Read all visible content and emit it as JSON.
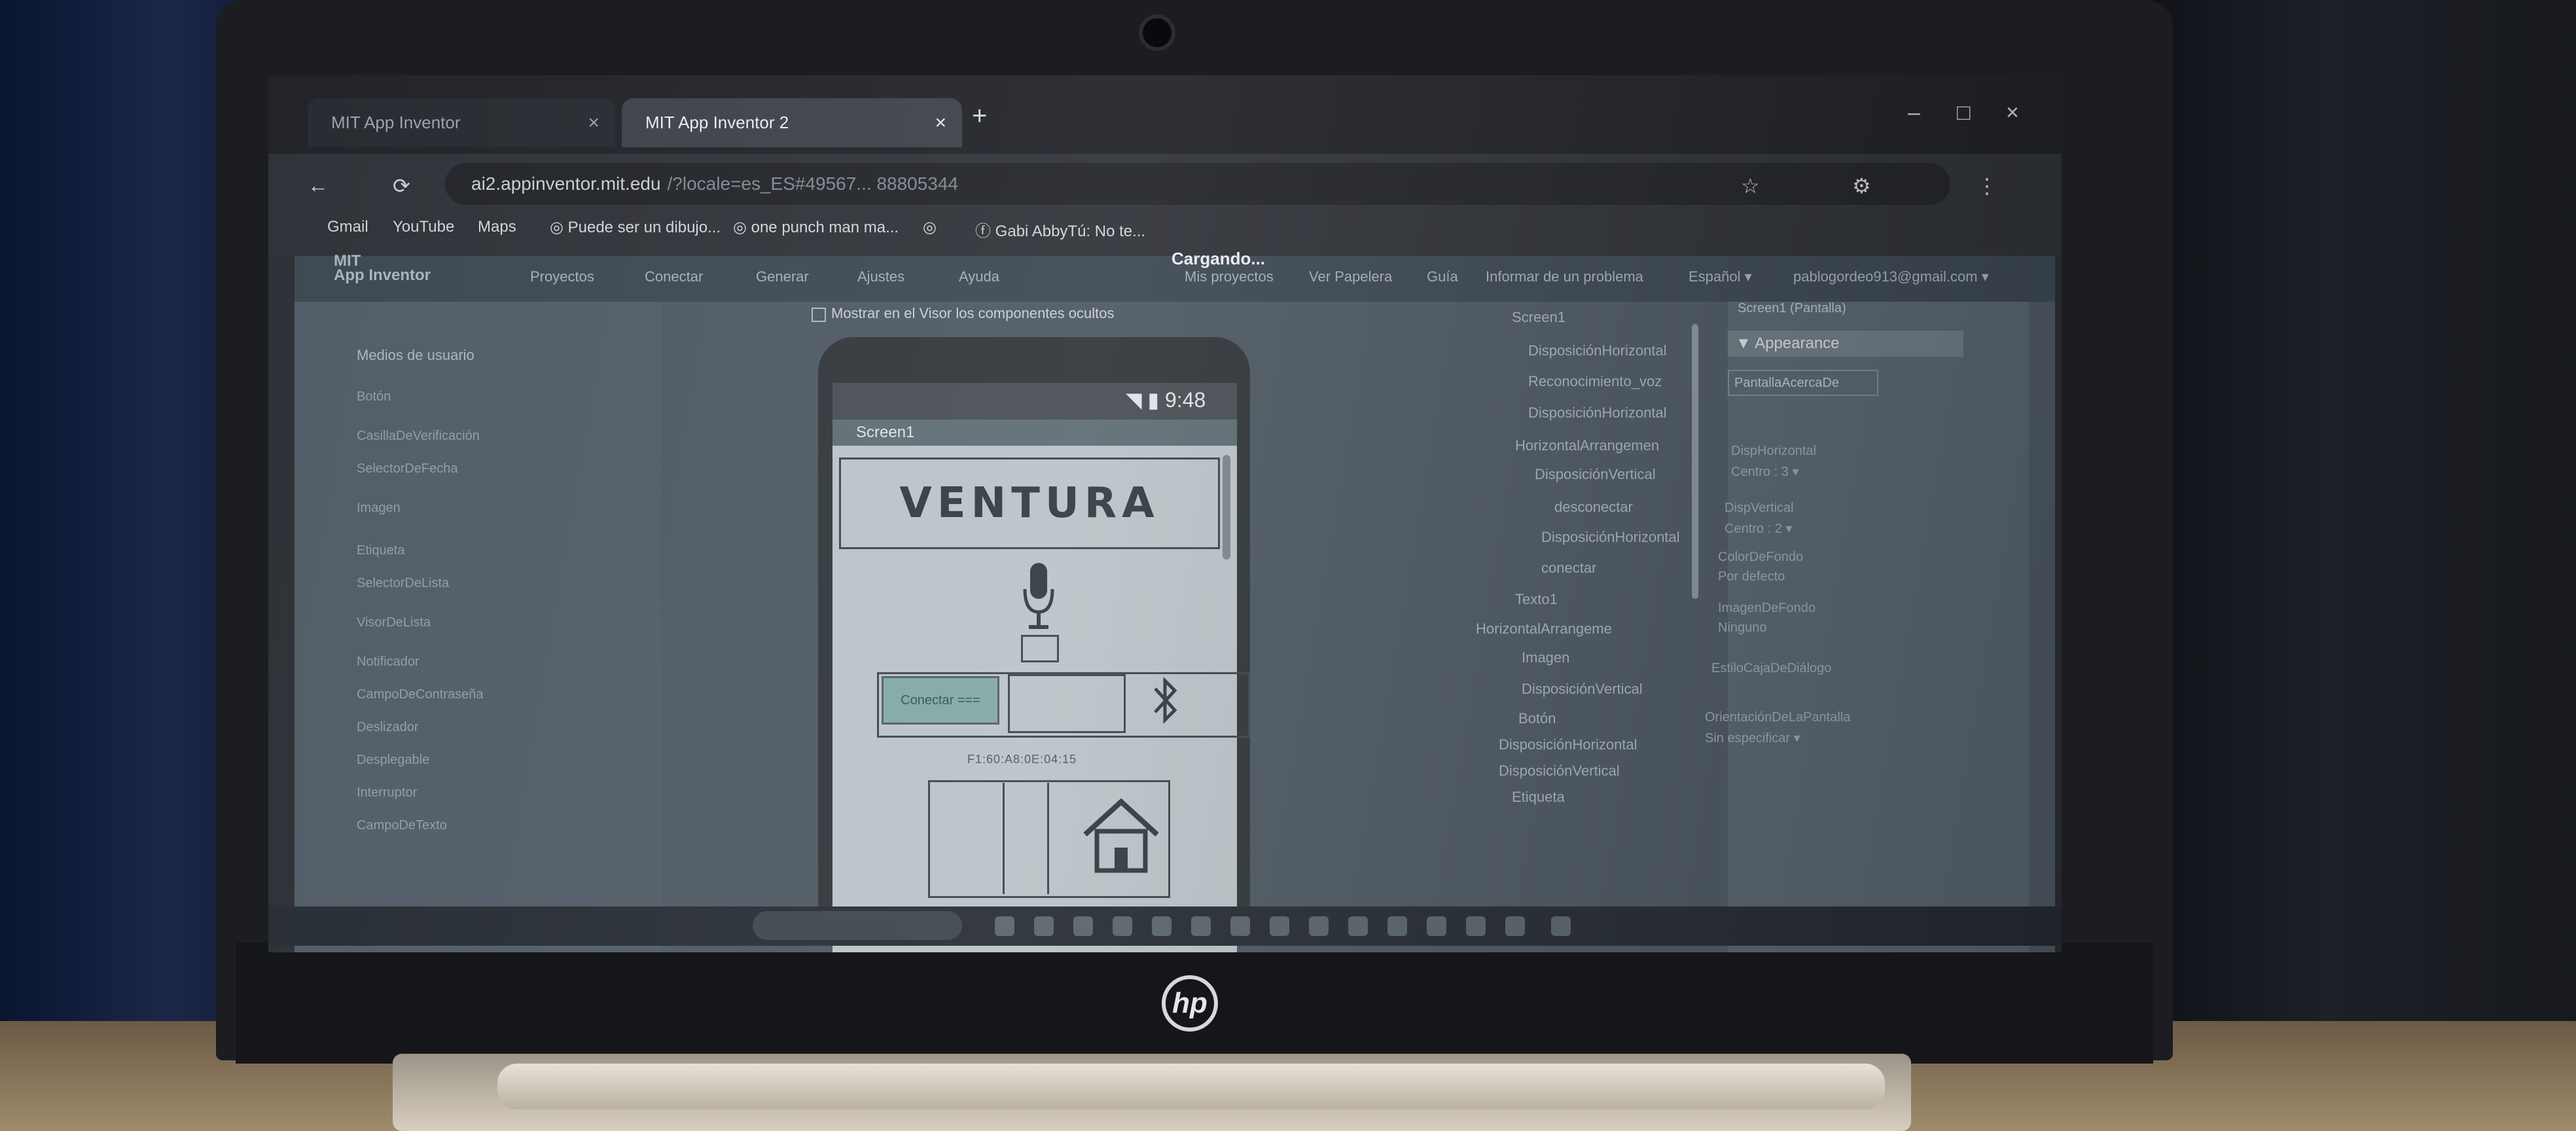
{
  "browser": {
    "tabs": [
      {
        "label": "MIT App Inventor"
      },
      {
        "label": "MIT App Inventor 2"
      }
    ],
    "tab_close_glyph": "×",
    "new_tab_glyph": "+",
    "url": "ai2.appinventor.mit.edu",
    "url_rest": "/?locale=es_ES#49567... 88805344",
    "bookmarks": [
      {
        "label": "Gmail"
      },
      {
        "label": "YouTube"
      },
      {
        "label": "Maps"
      },
      {
        "label": "Puede ser un dibujo..."
      },
      {
        "label": "one punch man ma..."
      },
      {
        "label": ""
      },
      {
        "label": "Gabi AbbyTú: No te..."
      }
    ],
    "window_controls": {
      "minimize": "–",
      "maximize": "□",
      "close": "×"
    }
  },
  "app": {
    "logo": "MIT\nApp Inventor",
    "loading_text": "Cargando...",
    "menu": [
      "Proyectos",
      "Conectar",
      "Generar",
      "Ajustes",
      "Ayuda"
    ],
    "right_menu": [
      "Mis proyectos",
      "Ver Papelera",
      "Guía",
      "Informar de un problema",
      "Español ▾",
      "pablogordeo913@gmail.com ▾"
    ],
    "palette_title": "Medios de usuario",
    "palette_items": [
      "Botón",
      "CasillaDeVerificación",
      "SelectorDeFecha",
      "Imagen",
      "Etiqueta",
      "SelectorDeLista",
      "VisorDeLista",
      "Notificador",
      "CampoDeContraseña",
      "Deslizador",
      "Desplegable",
      "Interruptor",
      "CampoDeTexto"
    ],
    "viewer_option": "Mostrar en el Visor los componentes ocultos"
  },
  "phone": {
    "status_time": "9:48",
    "screen_title": "Screen1",
    "ventura_label": "VENTURA",
    "connect_button": "Conectar ===",
    "status_label": "F1:60:A8:0E:04:15"
  },
  "components": [
    {
      "label": "Screen1",
      "indent": 0
    },
    {
      "label": "DisposiciónHorizontal",
      "indent": 1
    },
    {
      "label": "Reconocimiento_voz",
      "indent": 1
    },
    {
      "label": "DisposiciónHorizontal",
      "indent": 1
    },
    {
      "label": "HorizontalArrangemen",
      "indent": 1
    },
    {
      "label": "DisposiciónVertical",
      "indent": 2
    },
    {
      "label": "desconectar",
      "indent": 3
    },
    {
      "label": "DisposiciónHorizontal",
      "indent": 2
    },
    {
      "label": "conectar",
      "indent": 2
    },
    {
      "label": "Texto1",
      "indent": 1
    },
    {
      "label": "HorizontalArrangeme",
      "indent": 1
    },
    {
      "label": "Imagen",
      "indent": 2
    },
    {
      "label": "DisposiciónVertical",
      "indent": 2
    },
    {
      "label": "Botón",
      "indent": 2
    },
    {
      "label": "DisposiciónHorizontal",
      "indent": 1
    },
    {
      "label": "DisposiciónVertical",
      "indent": 1
    },
    {
      "label": "Etiqueta",
      "indent": 1
    }
  ],
  "properties": {
    "header": "Screen1 (Pantalla)",
    "section": "▼ Appearance",
    "items": [
      {
        "label": "PantallaAcercaDe",
        "value": ""
      },
      {
        "label": "DispHorizontal",
        "value": "Centro : 3 ▾"
      },
      {
        "label": "DispVertical",
        "value": "Centro : 2 ▾"
      },
      {
        "label": "ColorDeFondo",
        "value": "Por defecto"
      },
      {
        "label": "ImagenDeFondo",
        "value": "Ninguno"
      },
      {
        "label": "EstiloCajaDeDiálogo",
        "value": ""
      },
      {
        "label": "OrientaciónDeLaPantalla",
        "value": "Sin especificar ▾"
      }
    ]
  },
  "icons": {
    "mic": "microphone-icon",
    "bluetooth": "bluetooth-icon",
    "home": "home-icon"
  }
}
